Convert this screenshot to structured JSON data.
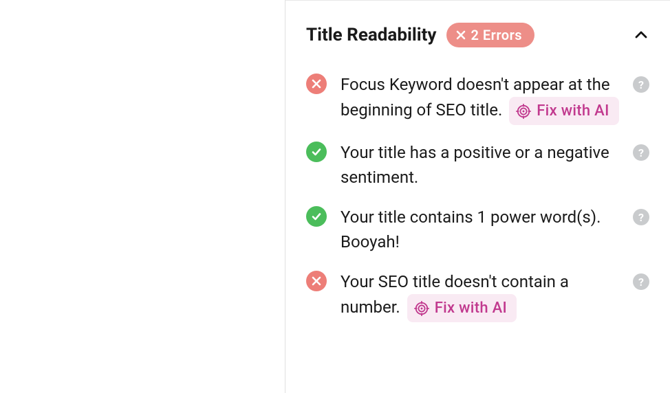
{
  "section": {
    "title": "Title Readability",
    "error_badge": "2 Errors"
  },
  "items": [
    {
      "status": "error",
      "text": "Focus Keyword doesn't appear at the beginning of SEO title.",
      "fix_label": "Fix with AI",
      "has_fix": true
    },
    {
      "status": "success",
      "text": "Your title has a positive or a negative sentiment.",
      "has_fix": false
    },
    {
      "status": "success",
      "text": "Your title contains 1 power word(s). Booyah!",
      "has_fix": false
    },
    {
      "status": "error",
      "text": "Your SEO title doesn't contain a number.",
      "fix_label": "Fix with AI",
      "has_fix": true
    }
  ],
  "help_tooltip": "?"
}
